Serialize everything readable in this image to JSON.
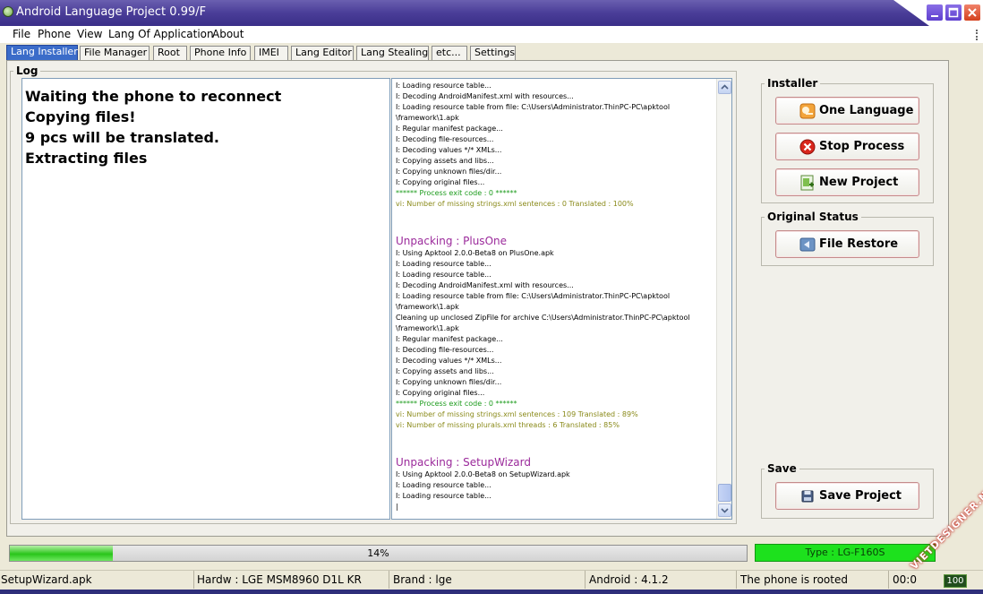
{
  "window": {
    "title": "Android Language Project 0.99/F",
    "min_icon": "minimize-icon",
    "max_icon": "maximize-icon",
    "close_icon": "close-icon"
  },
  "menu": [
    "File",
    "Phone",
    "View",
    "Lang Of Application",
    "About"
  ],
  "tabs": [
    "Lang Installer",
    "File Manager",
    "Root",
    "Phone Info",
    "IMEI",
    "Lang Editor",
    "Lang Stealing",
    "etc...",
    "Settings"
  ],
  "active_tab": "Lang Installer",
  "log": {
    "title": "Log",
    "status_lines": [
      "Waiting the phone to reconnect",
      "Copying files!",
      "9 pcs will be translated.",
      "Extracting files"
    ],
    "console": [
      {
        "t": "I: Loading resource table...",
        "k": "plain"
      },
      {
        "t": "I: Decoding AndroidManifest.xml with resources...",
        "k": "plain"
      },
      {
        "t": "I: Loading resource table from file: C:\\Users\\Administrator.ThinPC-PC\\apktool",
        "k": "plain"
      },
      {
        "t": "\\framework\\1.apk",
        "k": "plain"
      },
      {
        "t": "I: Regular manifest package...",
        "k": "plain"
      },
      {
        "t": "I: Decoding file-resources...",
        "k": "plain"
      },
      {
        "t": "I: Decoding values */* XMLs...",
        "k": "plain"
      },
      {
        "t": "I: Copying assets and libs...",
        "k": "plain"
      },
      {
        "t": "I: Copying unknown files/dir...",
        "k": "plain"
      },
      {
        "t": "I: Copying original files...",
        "k": "plain"
      },
      {
        "t": "****** Process exit code : 0 ******",
        "k": "ok"
      },
      {
        "t": "vi: Number of missing strings.xml sentences : 0 Translated : 100%",
        "k": "warn"
      },
      {
        "t": "",
        "k": "blank"
      },
      {
        "t": "",
        "k": "blank"
      },
      {
        "t": "Unpacking : PlusOne",
        "k": "head"
      },
      {
        "t": "I: Using Apktool 2.0.0-Beta8 on PlusOne.apk",
        "k": "plain"
      },
      {
        "t": "I: Loading resource table...",
        "k": "plain"
      },
      {
        "t": "I: Loading resource table...",
        "k": "plain"
      },
      {
        "t": "I: Decoding AndroidManifest.xml with resources...",
        "k": "plain"
      },
      {
        "t": "I: Loading resource table from file: C:\\Users\\Administrator.ThinPC-PC\\apktool",
        "k": "plain"
      },
      {
        "t": "\\framework\\1.apk",
        "k": "plain"
      },
      {
        "t": "Cleaning up unclosed ZipFile for archive C:\\Users\\Administrator.ThinPC-PC\\apktool",
        "k": "plain"
      },
      {
        "t": "\\framework\\1.apk",
        "k": "plain"
      },
      {
        "t": "I: Regular manifest package...",
        "k": "plain"
      },
      {
        "t": "I: Decoding file-resources...",
        "k": "plain"
      },
      {
        "t": "I: Decoding values */* XMLs...",
        "k": "plain"
      },
      {
        "t": "I: Copying assets and libs...",
        "k": "plain"
      },
      {
        "t": "I: Copying unknown files/dir...",
        "k": "plain"
      },
      {
        "t": "I: Copying original files...",
        "k": "plain"
      },
      {
        "t": "****** Process exit code : 0 ******",
        "k": "ok"
      },
      {
        "t": "vi: Number of missing strings.xml sentences : 109 Translated : 89%",
        "k": "warn"
      },
      {
        "t": "vi: Number of missing plurals.xml threads : 6 Translated : 85%",
        "k": "warn"
      },
      {
        "t": "",
        "k": "blank"
      },
      {
        "t": "",
        "k": "blank"
      },
      {
        "t": "Unpacking : SetupWizard",
        "k": "head"
      },
      {
        "t": "I: Using Apktool 2.0.0-Beta8 on SetupWizard.apk",
        "k": "plain"
      },
      {
        "t": "I: Loading resource table...",
        "k": "plain"
      },
      {
        "t": "I: Loading resource table...",
        "k": "plain"
      },
      {
        "t": "|",
        "k": "plain"
      }
    ]
  },
  "installer": {
    "title": "Installer",
    "one_language": "One Language",
    "stop_process": "Stop Process",
    "new_project": "New Project"
  },
  "original_status": {
    "title": "Original Status",
    "file_restore": "File Restore"
  },
  "save": {
    "title": "Save",
    "save_project": "Save Project"
  },
  "progress": {
    "percent": 14,
    "label": "14%"
  },
  "device_type": "Type : LG-F160S",
  "status_bar": {
    "file": "SetupWizard.apk",
    "hardware": "Hardw : LGE MSM8960 D1L KR",
    "brand": "Brand : lge",
    "android": "Android : 4.1.2",
    "root": "The phone is rooted",
    "time": "00:0"
  },
  "tray_badge": "100",
  "watermark": "VIETDESIGNER.NET",
  "colors": {
    "titlebar": "#4a3d98",
    "active_tab": "#3b6cc9",
    "progress_fill": "#29c51a",
    "type_box": "#1de11d",
    "console_ok": "#1c9b1c",
    "console_warn": "#8a8a1a",
    "console_head": "#9b2a9b"
  }
}
